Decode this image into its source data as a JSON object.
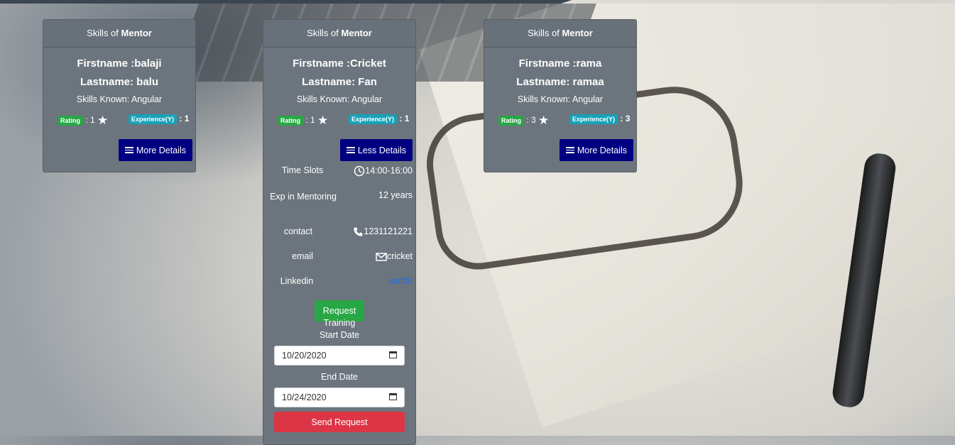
{
  "cards": [
    {
      "header_prefix": "Skills of",
      "header_strong": "Mentor",
      "firstname": "Firstname :balaji",
      "lastname": "Lastname: balu",
      "skills": "Skills Known: Angular",
      "rating_label": "Rating",
      "rating_value": ": 1",
      "experience_label": "Experience(Y)",
      "experience_value": ": 1",
      "details_button": "More Details"
    },
    {
      "header_prefix": "Skills of",
      "header_strong": "Mentor",
      "firstname": "Firstname :Cricket",
      "lastname": "Lastname: Fan",
      "skills": "Skills Known: Angular",
      "rating_label": "Rating",
      "rating_value": ": 1",
      "experience_label": "Experience(Y)",
      "experience_value": ": 1",
      "details_button": "Less Details",
      "details": {
        "time_slots_label": "Time Slots",
        "time_slots_value": "14:00-16:00",
        "exp_mentoring_label": "Exp in Mentoring",
        "exp_mentoring_value": "12 years",
        "contact_label": "contact",
        "contact_value": "1231121221",
        "email_label": "email",
        "email_value": "cricket",
        "linkedin_label": "Linkedin",
        "linkedin_value": "asdfbt"
      },
      "request_button": "Request",
      "request_caption": "Training",
      "start_date_label": "Start Date",
      "start_date_value": "10/20/2020",
      "end_date_label": "End Date",
      "end_date_value": "10/24/2020",
      "send_button": "Send Request"
    },
    {
      "header_prefix": "Skills of",
      "header_strong": "Mentor",
      "firstname": "Firstname :rama",
      "lastname": "Lastname: ramaa",
      "skills": "Skills Known: Angular",
      "rating_label": "Rating",
      "rating_value": ": 3",
      "experience_label": "Experience(Y)",
      "experience_value": ": 3",
      "details_button": "More Details"
    }
  ],
  "colors": {
    "card_bg": "#6c757d",
    "details_button": "#000080",
    "request_button": "#28a745",
    "send_button": "#dc3545",
    "rating_badge": "#28a745",
    "experience_badge": "#17a2b8",
    "link": "#2b6de0"
  },
  "icons": [
    "star-icon",
    "hamburger-icon",
    "clock-icon",
    "phone-icon",
    "mail-icon",
    "calendar-icon"
  ]
}
